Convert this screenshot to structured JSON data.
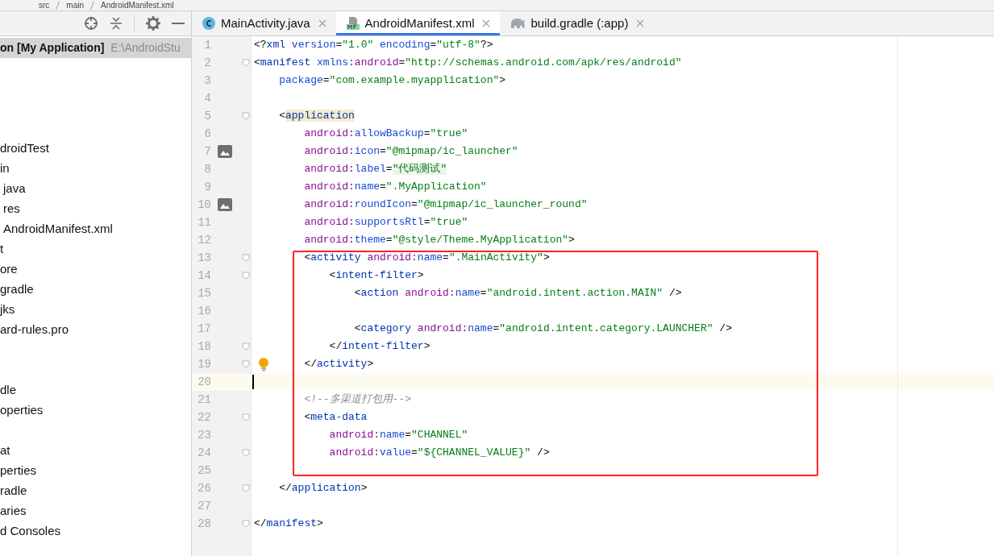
{
  "breadcrumb": [
    "src",
    "main",
    "AndroidManifest.xml"
  ],
  "project_panel": {
    "root": {
      "name": "on [My Application]",
      "path": "E:\\AndroidStu",
      "selected": true
    },
    "items": [
      {
        "label": "droidTest"
      },
      {
        "label": "in"
      },
      {
        "label": "java"
      },
      {
        "label": "res"
      },
      {
        "label": "AndroidManifest.xml"
      },
      {
        "label": "t"
      },
      {
        "label": "ore"
      },
      {
        "label": "gradle"
      },
      {
        "label": "jks"
      },
      {
        "label": "ard-rules.pro"
      },
      {
        "label": "dle"
      },
      {
        "label": "operties"
      },
      {
        "label": "at"
      },
      {
        "label": "perties"
      },
      {
        "label": "radle"
      },
      {
        "label": "aries"
      },
      {
        "label": "d Consoles"
      }
    ]
  },
  "tabs": [
    {
      "label": "MainActivity.java",
      "kind": "java",
      "selected": false
    },
    {
      "label": "AndroidManifest.xml",
      "kind": "manifest",
      "selected": true
    },
    {
      "label": "build.gradle (:app)",
      "kind": "gradle",
      "selected": false
    }
  ],
  "editor": {
    "lines": [
      {
        "n": "1",
        "fold": false,
        "current": false,
        "tokens": [
          {
            "kind": "punct",
            "text": "<?"
          },
          {
            "kind": "tag",
            "text": "xml "
          },
          {
            "kind": "attr",
            "text": "version"
          },
          {
            "kind": "punct",
            "text": "="
          },
          {
            "kind": "value",
            "text": "\"1.0\" "
          },
          {
            "kind": "attr",
            "text": "encoding"
          },
          {
            "kind": "punct",
            "text": "="
          },
          {
            "kind": "value",
            "text": "\"utf-8\""
          },
          {
            "kind": "punct",
            "text": "?>"
          }
        ]
      },
      {
        "n": "2",
        "fold": true,
        "current": false,
        "tokens": [
          {
            "kind": "punct",
            "text": "<"
          },
          {
            "kind": "tag",
            "text": "manifest "
          },
          {
            "kind": "attr",
            "text": "xmlns:"
          },
          {
            "kind": "ns",
            "text": "android"
          },
          {
            "kind": "punct",
            "text": "="
          },
          {
            "kind": "value",
            "text": "\"http://schemas.android.com/apk/res/android\""
          }
        ],
        "children": [
          {
            "n": "3",
            "fold": false,
            "current": false,
            "tokens": [
              {
                "kind": "attr",
                "text": "package"
              },
              {
                "kind": "punct",
                "text": "="
              },
              {
                "kind": "value",
                "text": "\"com.example.myapplication\""
              },
              {
                "kind": "punct",
                "text": ">"
              }
            ]
          },
          {
            "n": "4",
            "fold": false,
            "current": false
          },
          {
            "n": "5",
            "fold": true,
            "current": false,
            "tokens": [
              {
                "kind": "punct",
                "text": "<"
              },
              {
                "kind": "tagmark",
                "text": "application"
              }
            ],
            "children": [
              {
                "n": "6",
                "fold": false,
                "current": false,
                "tokens": [
                  {
                    "kind": "ns",
                    "text": "android:"
                  },
                  {
                    "kind": "attr",
                    "text": "allowBackup"
                  },
                  {
                    "kind": "punct",
                    "text": "="
                  },
                  {
                    "kind": "value",
                    "text": "\"true\""
                  }
                ]
              },
              {
                "n": "7",
                "kind": "image",
                "fold": false,
                "current": false,
                "tokens": [
                  {
                    "kind": "ns",
                    "text": "android:"
                  },
                  {
                    "kind": "attr",
                    "text": "icon"
                  },
                  {
                    "kind": "punct",
                    "text": "="
                  },
                  {
                    "kind": "value",
                    "text": "\"@mipmap/ic_launcher\""
                  }
                ]
              },
              {
                "n": "8",
                "fold": false,
                "current": false,
                "tokens": [
                  {
                    "kind": "ns",
                    "text": "android:"
                  },
                  {
                    "kind": "attr",
                    "text": "label"
                  },
                  {
                    "kind": "punct",
                    "text": "="
                  },
                  {
                    "kind": "valuemark",
                    "text": "\"代码测试\""
                  }
                ]
              },
              {
                "n": "9",
                "fold": false,
                "current": false,
                "tokens": [
                  {
                    "kind": "ns",
                    "text": "android:"
                  },
                  {
                    "kind": "attr",
                    "text": "name"
                  },
                  {
                    "kind": "punct",
                    "text": "="
                  },
                  {
                    "kind": "value",
                    "text": "\".MyApplication\""
                  }
                ]
              },
              {
                "n": "10",
                "kind": "image",
                "fold": false,
                "current": false,
                "tokens": [
                  {
                    "kind": "ns",
                    "text": "android:"
                  },
                  {
                    "kind": "attr",
                    "text": "roundIcon"
                  },
                  {
                    "kind": "punct",
                    "text": "="
                  },
                  {
                    "kind": "value",
                    "text": "\"@mipmap/ic_launcher_round\""
                  }
                ]
              },
              {
                "n": "11",
                "fold": false,
                "current": false,
                "tokens": [
                  {
                    "kind": "ns",
                    "text": "android:"
                  },
                  {
                    "kind": "attr",
                    "text": "supportsRtl"
                  },
                  {
                    "kind": "punct",
                    "text": "="
                  },
                  {
                    "kind": "value",
                    "text": "\"true\""
                  }
                ]
              },
              {
                "n": "12",
                "fold": false,
                "current": false,
                "tokens": [
                  {
                    "kind": "ns",
                    "text": "android:"
                  },
                  {
                    "kind": "attr",
                    "text": "theme"
                  },
                  {
                    "kind": "punct",
                    "text": "="
                  },
                  {
                    "kind": "value",
                    "text": "\"@style/Theme.MyApplication\""
                  },
                  {
                    "kind": "punct",
                    "text": ">"
                  }
                ]
              },
              {
                "n": "13",
                "fold": true,
                "current": false,
                "tokens": [
                  {
                    "kind": "punct",
                    "text": "<"
                  },
                  {
                    "kind": "tag",
                    "text": "activity "
                  },
                  {
                    "kind": "ns",
                    "text": "android:"
                  },
                  {
                    "kind": "attr",
                    "text": "name"
                  },
                  {
                    "kind": "punct",
                    "text": "="
                  },
                  {
                    "kind": "value",
                    "text": "\".MainActivity\""
                  },
                  {
                    "kind": "punct",
                    "text": ">"
                  }
                ],
                "children": [
                  {
                    "n": "14",
                    "fold": true,
                    "current": false,
                    "tokens": [
                      {
                        "kind": "punct",
                        "text": "<"
                      },
                      {
                        "kind": "tag",
                        "text": "intent-filter"
                      },
                      {
                        "kind": "punct",
                        "text": ">"
                      }
                    ],
                    "children": [
                      {
                        "n": "15",
                        "fold": false,
                        "current": false,
                        "tokens": [
                          {
                            "kind": "punct",
                            "text": "<"
                          },
                          {
                            "kind": "tag",
                            "text": "action "
                          },
                          {
                            "kind": "ns",
                            "text": "android:"
                          },
                          {
                            "kind": "attr",
                            "text": "name"
                          },
                          {
                            "kind": "punct",
                            "text": "="
                          },
                          {
                            "kind": "value",
                            "text": "\"android.intent.action.MAIN\" "
                          },
                          {
                            "kind": "punct",
                            "text": "/>"
                          }
                        ]
                      },
                      {
                        "n": "16",
                        "fold": false,
                        "current": false
                      },
                      {
                        "n": "17",
                        "fold": false,
                        "current": false,
                        "tokens": [
                          {
                            "kind": "punct",
                            "text": "<"
                          },
                          {
                            "kind": "tag",
                            "text": "category "
                          },
                          {
                            "kind": "ns",
                            "text": "android:"
                          },
                          {
                            "kind": "attr",
                            "text": "name"
                          },
                          {
                            "kind": "punct",
                            "text": "="
                          },
                          {
                            "kind": "value",
                            "text": "\"android.intent.category.LAUNCHER\" "
                          },
                          {
                            "kind": "punct",
                            "text": "/>"
                          }
                        ]
                      }
                    ]
                  },
                  {
                    "n": "18",
                    "fold": true,
                    "current": false,
                    "tokens": [
                      {
                        "kind": "punct",
                        "text": "</"
                      },
                      {
                        "kind": "tag",
                        "text": "intent-filter"
                      },
                      {
                        "kind": "punct",
                        "text": ">"
                      }
                    ]
                  }
                ]
              },
              {
                "n": "19",
                "kind": "bulb",
                "fold": true,
                "current": false,
                "tokens": [
                  {
                    "kind": "punct",
                    "text": "</"
                  },
                  {
                    "kind": "tag",
                    "text": "activity"
                  },
                  {
                    "kind": "punct",
                    "text": ">"
                  }
                ]
              },
              {
                "n": "20",
                "fold": false,
                "current": true
              },
              {
                "n": "21",
                "fold": false,
                "current": false,
                "tokens": [
                  {
                    "kind": "comment",
                    "text": "<!--多渠道打包用-->"
                  }
                ]
              },
              {
                "n": "22",
                "fold": true,
                "current": false,
                "tokens": [
                  {
                    "kind": "punct",
                    "text": "<"
                  },
                  {
                    "kind": "tag",
                    "text": "meta-data"
                  }
                ],
                "children": [
                  {
                    "n": "23",
                    "fold": false,
                    "current": false,
                    "tokens": [
                      {
                        "kind": "ns",
                        "text": "android:"
                      },
                      {
                        "kind": "attr",
                        "text": "name"
                      },
                      {
                        "kind": "punct",
                        "text": "="
                      },
                      {
                        "kind": "value",
                        "text": "\"CHANNEL\""
                      }
                    ]
                  },
                  {
                    "n": "24",
                    "fold": true,
                    "current": false,
                    "tokens": [
                      {
                        "kind": "ns",
                        "text": "android:"
                      },
                      {
                        "kind": "attr",
                        "text": "value"
                      },
                      {
                        "kind": "punct",
                        "text": "="
                      },
                      {
                        "kind": "value",
                        "text": "\"${CHANNEL_VALUE}\" "
                      },
                      {
                        "kind": "punct",
                        "text": "/>"
                      }
                    ]
                  }
                ]
              },
              {
                "n": "25",
                "fold": false,
                "current": false
              }
            ]
          },
          {
            "n": "26",
            "fold": true,
            "current": false,
            "tokens": [
              {
                "kind": "punct",
                "text": "</"
              },
              {
                "kind": "tag",
                "text": "application"
              },
              {
                "kind": "punct",
                "text": ">"
              }
            ]
          },
          {
            "n": "27",
            "fold": false,
            "current": false
          }
        ]
      },
      {
        "n": "28",
        "fold": true,
        "current": false,
        "tokens": [
          {
            "kind": "punct",
            "text": "</"
          },
          {
            "kind": "tag",
            "text": "manifest"
          },
          {
            "kind": "punct",
            "text": ">"
          }
        ]
      }
    ]
  }
}
